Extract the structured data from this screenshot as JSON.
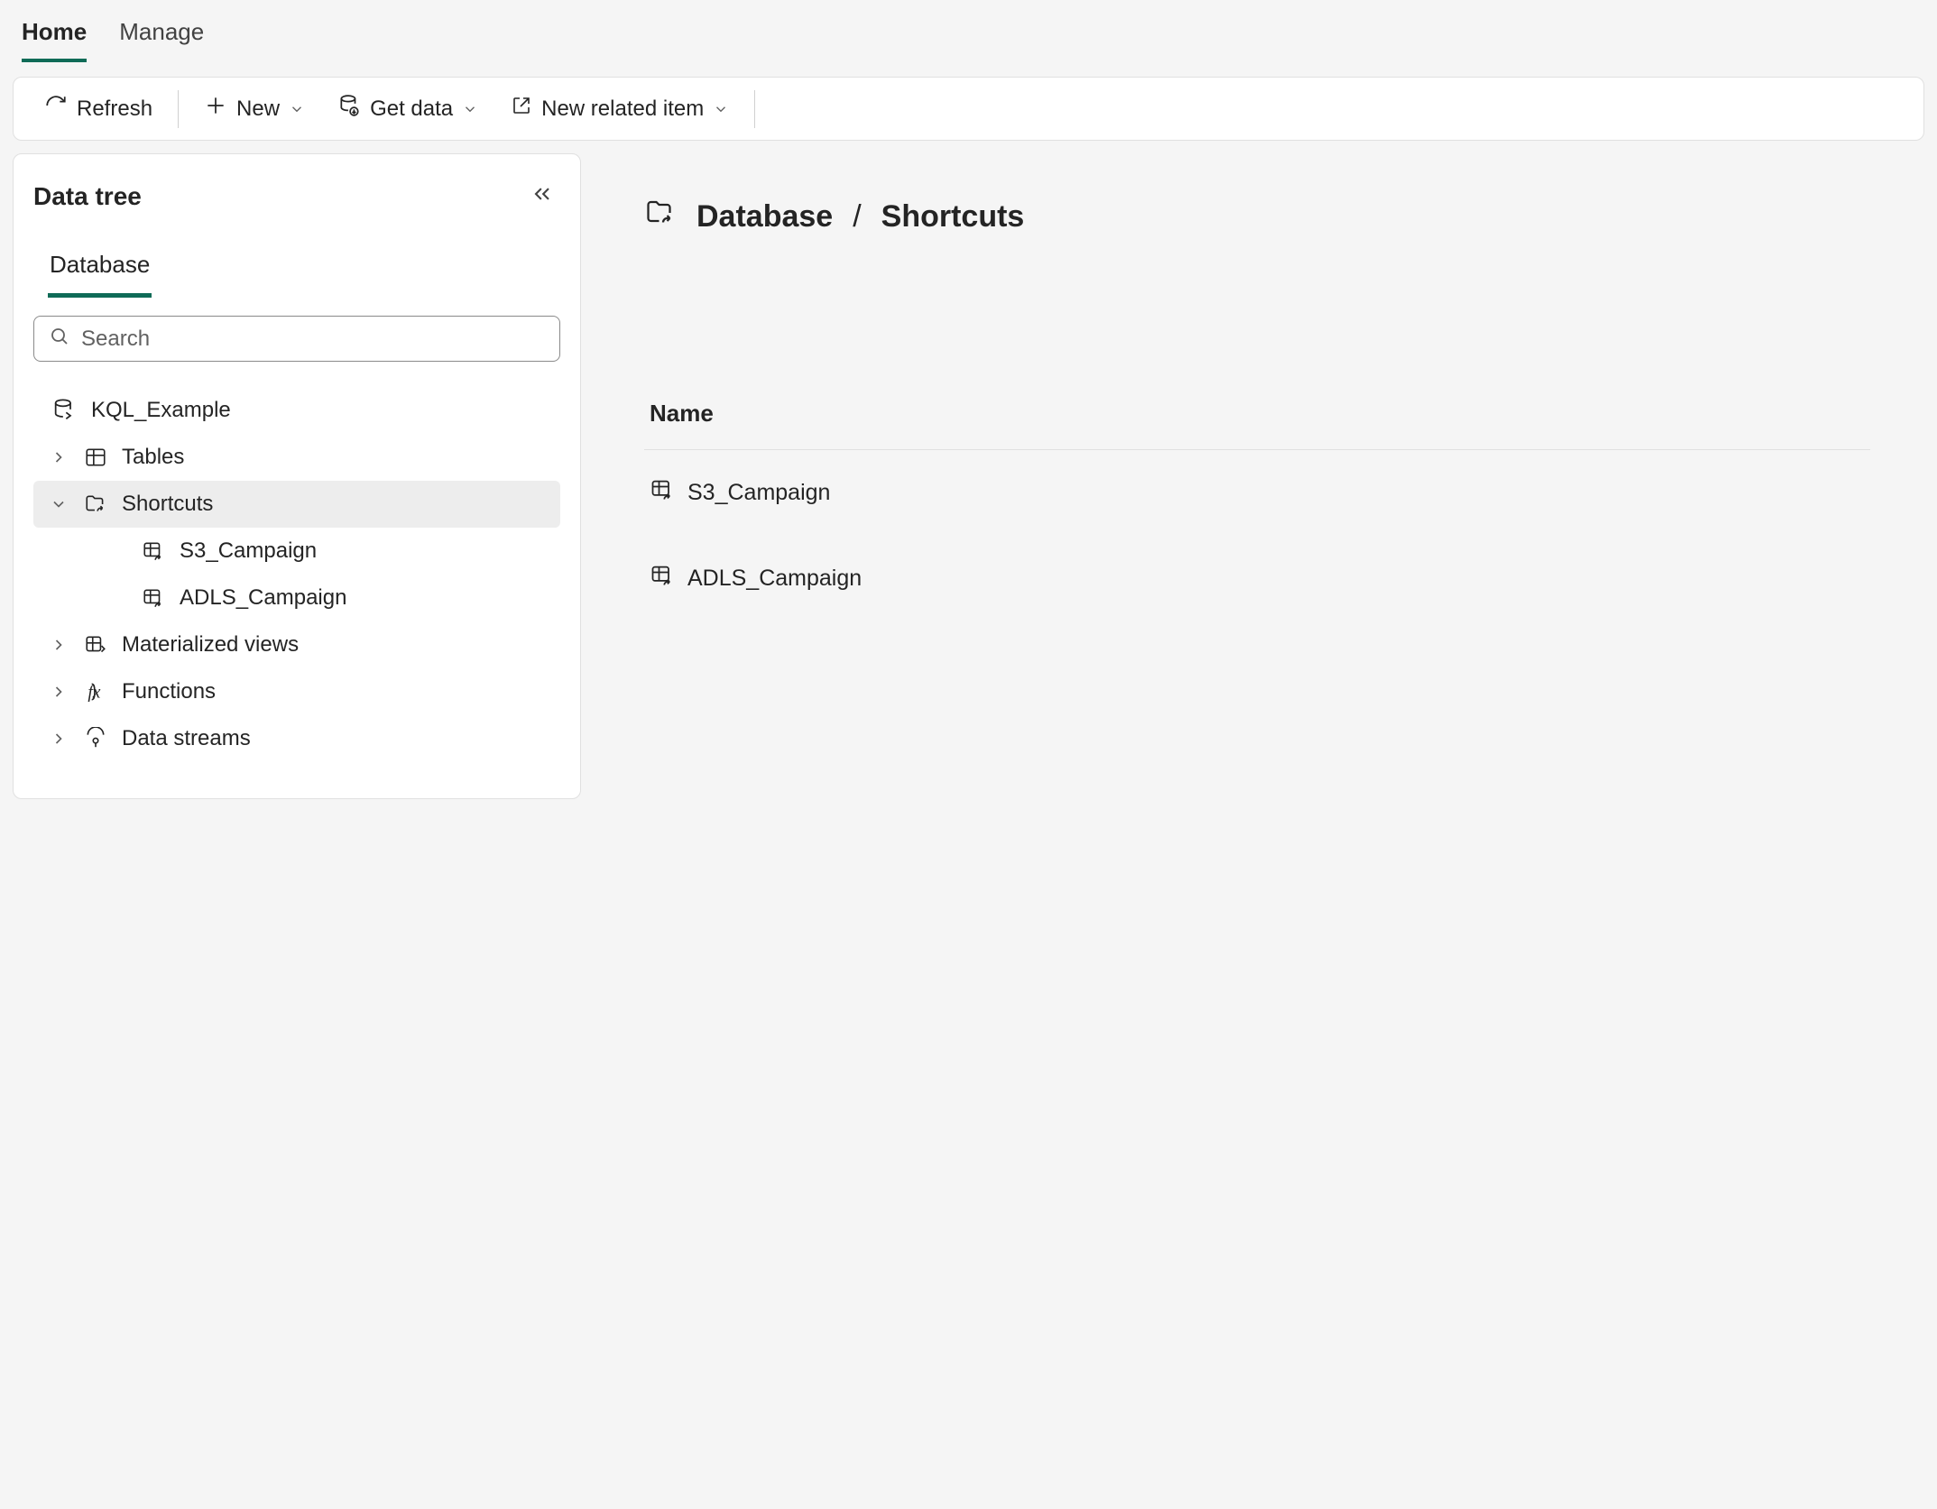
{
  "tabs": {
    "home": "Home",
    "manage": "Manage"
  },
  "toolbar": {
    "refresh": "Refresh",
    "new": "New",
    "get_data": "Get data",
    "new_related": "New related item"
  },
  "sidebar": {
    "title": "Data tree",
    "sub_tab": "Database",
    "search_placeholder": "Search",
    "root": "KQL_Example",
    "nodes": {
      "tables": "Tables",
      "shortcuts": "Shortcuts",
      "materialized": "Materialized views",
      "functions": "Functions",
      "streams": "Data streams"
    },
    "shortcuts_children": {
      "s3": "S3_Campaign",
      "adls": "ADLS_Campaign"
    }
  },
  "breadcrumb": {
    "part1": "Database",
    "part2": "Shortcuts"
  },
  "table": {
    "header_name": "Name",
    "rows": {
      "r1": "S3_Campaign",
      "r2": "ADLS_Campaign"
    }
  }
}
